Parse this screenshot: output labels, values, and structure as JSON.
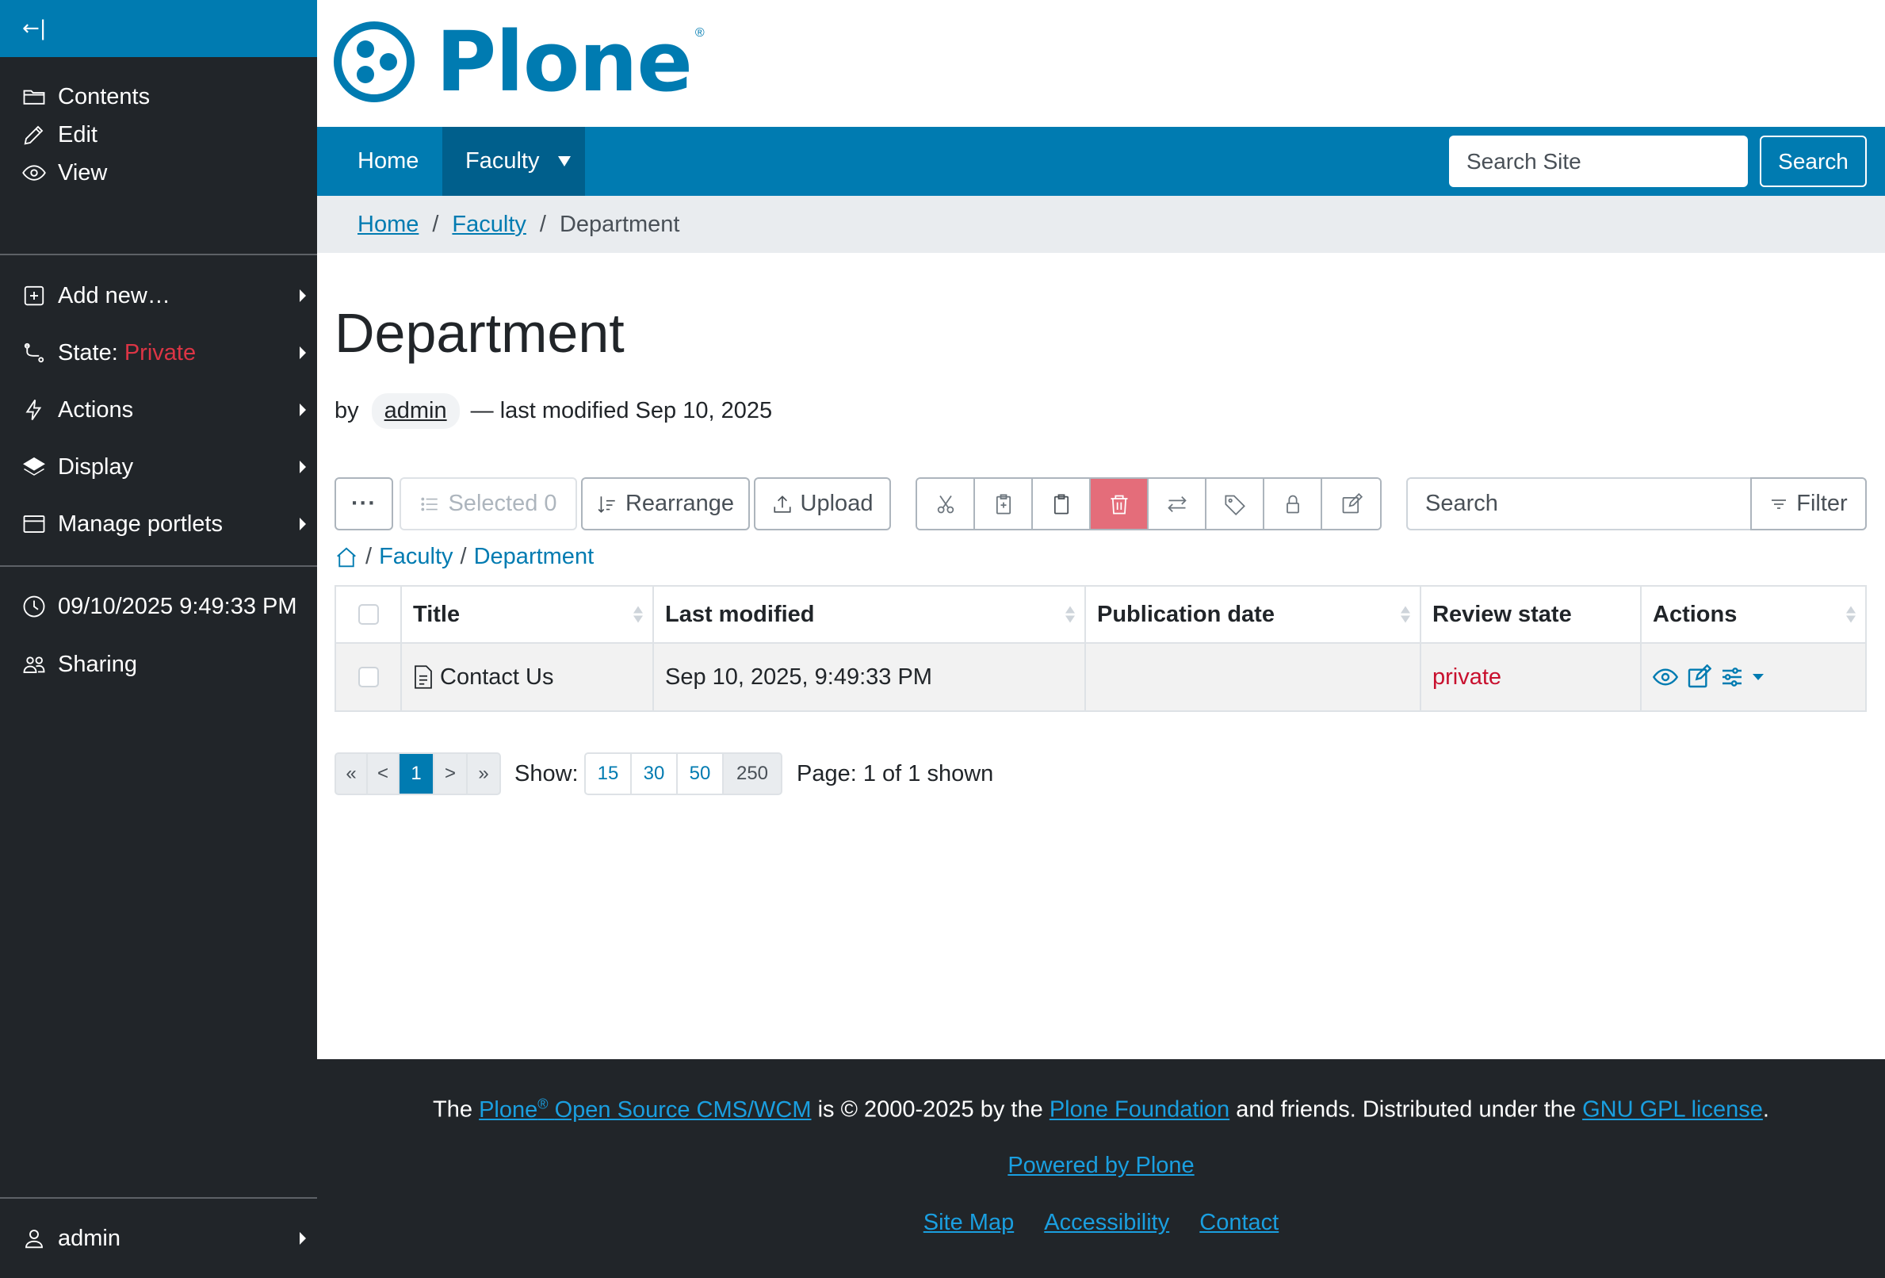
{
  "toolbar": {
    "collapse_glyph": "←|",
    "items": [
      {
        "label": "Contents",
        "icon": "folder-icon"
      },
      {
        "label": "Edit",
        "icon": "pencil-icon"
      },
      {
        "label": "View",
        "icon": "eye-icon"
      },
      {
        "label": "Add new…",
        "icon": "plus-square-icon"
      },
      {
        "label": "State:",
        "value": "Private",
        "icon": "workflow-icon"
      },
      {
        "label": "Actions",
        "icon": "lightning-icon"
      },
      {
        "label": "Display",
        "icon": "layers-icon"
      },
      {
        "label": "Manage portlets",
        "icon": "window-icon"
      },
      {
        "label": "09/10/2025 9:49:33 PM",
        "icon": "clock-icon"
      },
      {
        "label": "Sharing",
        "icon": "people-icon"
      }
    ],
    "user": {
      "label": "admin",
      "icon": "person-icon"
    }
  },
  "header": {
    "logo_text": "Plone",
    "logo_reg": "®"
  },
  "nav": {
    "items": [
      "Home",
      "Faculty"
    ],
    "search_placeholder": "Search Site",
    "search_button": "Search"
  },
  "breadcrumb": {
    "items": [
      "Home",
      "Faculty",
      "Department"
    ],
    "separator": "/"
  },
  "page": {
    "title": "Department",
    "by": "by",
    "author": "admin",
    "modified": "— last modified Sep 10, 2025"
  },
  "folder_contents": {
    "more_label": "···",
    "selected_label": "Selected 0",
    "rearrange_label": "Rearrange",
    "upload_label": "Upload",
    "search_placeholder": "Search",
    "filter_label": "Filter",
    "path": [
      "Faculty",
      "Department"
    ],
    "columns": [
      "Title",
      "Last modified",
      "Publication date",
      "Review state",
      "Actions"
    ],
    "rows": [
      {
        "title": "Contact Us",
        "last_modified": "Sep 10, 2025, 9:49:33 PM",
        "publication_date": "",
        "review_state": "private"
      }
    ]
  },
  "pagination": {
    "first": "«",
    "prev": "<",
    "current": "1",
    "next": ">",
    "last": "»",
    "show_label": "Show:",
    "sizes": [
      "15",
      "30",
      "50",
      "250"
    ],
    "page_info": "Page: 1 of 1 shown"
  },
  "footer": {
    "line1_pre": "The",
    "plone_link": "Plone",
    "reg": "®",
    "cms_link": "Open Source CMS/WCM",
    "line1_mid": "is © 2000-2025 by the",
    "foundation_link": "Plone Foundation",
    "line1_mid2": "and friends. Distributed under the",
    "gpl_link": "GNU GPL license",
    "line1_end": ".",
    "powered": "Powered by Plone",
    "links": [
      "Site Map",
      "Accessibility",
      "Contact"
    ]
  },
  "colors": {
    "brand": "#007bb1",
    "sidebar": "#212529",
    "danger": "#dc3545",
    "delete_bg": "#e46d7a"
  }
}
